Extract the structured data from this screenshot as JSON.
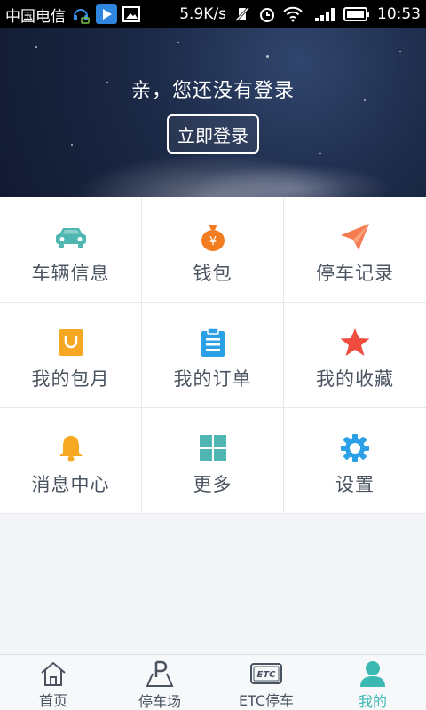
{
  "status_bar": {
    "carrier": "中国电信",
    "speed": "5.9K/s",
    "time": "10:53"
  },
  "header": {
    "greeting": "亲，您还没有登录",
    "login_label": "立即登录"
  },
  "grid": [
    {
      "label": "车辆信息",
      "icon": "car-icon",
      "color": "#4fb6b1"
    },
    {
      "label": "钱包",
      "icon": "money-bag-icon",
      "color": "#f47c20"
    },
    {
      "label": "停车记录",
      "icon": "paper-plane-icon",
      "color": "#f47c50"
    },
    {
      "label": "我的包月",
      "icon": "shopping-bag-icon",
      "color": "#f7a823"
    },
    {
      "label": "我的订单",
      "icon": "clipboard-icon",
      "color": "#2ba0e6"
    },
    {
      "label": "我的收藏",
      "icon": "star-icon",
      "color": "#ef4b3f"
    },
    {
      "label": "消息中心",
      "icon": "bell-icon",
      "color": "#f7a823"
    },
    {
      "label": "更多",
      "icon": "grid-icon",
      "color": "#4fb6b1"
    },
    {
      "label": "设置",
      "icon": "gear-icon",
      "color": "#2ba0e6"
    }
  ],
  "tabs": [
    {
      "label": "首页",
      "icon": "home-icon"
    },
    {
      "label": "停车场",
      "icon": "parking-icon"
    },
    {
      "label": "ETC停车",
      "icon": "etc-card-icon",
      "icon_text": "ETC"
    },
    {
      "label": "我的",
      "icon": "person-icon",
      "active": true
    }
  ],
  "colors": {
    "accent": "#3bb8b2",
    "text": "#4a5360"
  }
}
